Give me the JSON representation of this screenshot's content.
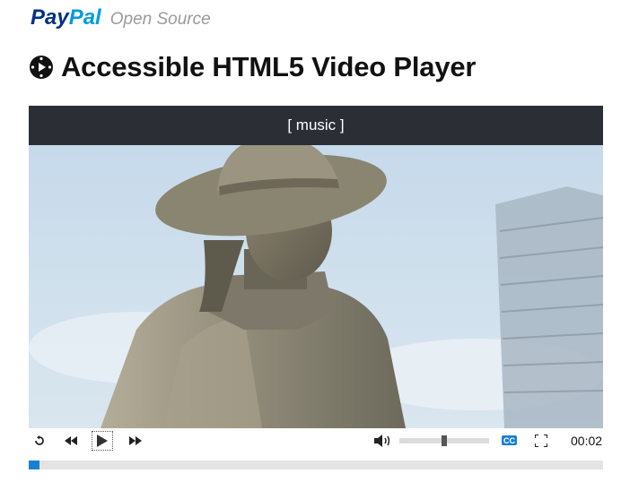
{
  "header": {
    "brand_pay": "Pay",
    "brand_pal": "Pal",
    "brand_sub": "Open Source"
  },
  "page": {
    "title": "Accessible HTML5 Video Player",
    "title_icon": "video-player-icon"
  },
  "player": {
    "caption": "[ music ]",
    "time": "00:02",
    "cc_label": "CC",
    "volume_fraction": 0.5,
    "progress_fraction": 0.017,
    "controls": {
      "rewind_icon": "rewind-icon",
      "restart_icon": "restart-icon",
      "play_icon": "play-icon",
      "fast_forward_icon": "fast-forward-icon",
      "volume_icon": "volume-icon",
      "fullscreen_icon": "fullscreen-icon"
    }
  },
  "colors": {
    "paypal_dark": "#003087",
    "paypal_light": "#009cde",
    "caption_bar": "#2b2f35",
    "accent": "#1a7fd0"
  }
}
